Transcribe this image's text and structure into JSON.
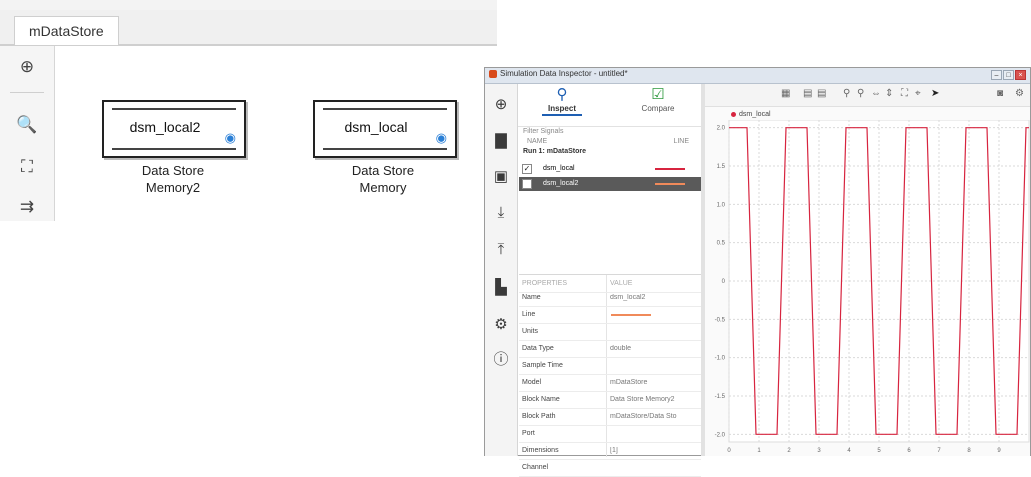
{
  "simulink": {
    "tab_label": "mDataStore",
    "toolbar_icons": [
      "navigate-back-icon",
      "zoom-in-icon",
      "fit-to-view-icon",
      "signal-routing-icon"
    ],
    "blocks": [
      {
        "label": "dsm_local2",
        "caption_line1": "Data Store",
        "caption_line2": "Memory2"
      },
      {
        "label": "dsm_local",
        "caption_line1": "Data Store",
        "caption_line2": "Memory"
      }
    ]
  },
  "sdi": {
    "title": "Simulation Data Inspector - untitled*",
    "window_buttons": [
      "–",
      "□",
      "×"
    ],
    "left_icons": [
      "new-icon",
      "folder-icon",
      "save-icon",
      "import-icon",
      "export-icon",
      "report-icon",
      "settings-icon",
      "help-icon"
    ],
    "modes": {
      "inspect": "Inspect",
      "compare": "Compare"
    },
    "filter_placeholder": "Filter Signals",
    "signal_columns": [
      "NAME",
      "LINE"
    ],
    "run_label": "Run 1: mDataStore",
    "signals": [
      {
        "name": "dsm_local",
        "checked": "✓",
        "line_color": "#d7243f"
      },
      {
        "name": "dsm_local2",
        "checked": "",
        "line_color": "#f08a5a"
      }
    ],
    "properties_header": {
      "key": "PROPERTIES",
      "value": "VALUE"
    },
    "properties": [
      {
        "key": "Name",
        "value": "dsm_local2"
      },
      {
        "key": "Line",
        "value": ""
      },
      {
        "key": "Units",
        "value": ""
      },
      {
        "key": "Data Type",
        "value": "double"
      },
      {
        "key": "Sample Time",
        "value": ""
      },
      {
        "key": "Model",
        "value": "mDataStore"
      },
      {
        "key": "Block Name",
        "value": "Data Store Memory2"
      },
      {
        "key": "Block Path",
        "value": "mDataStore/Data Sto"
      },
      {
        "key": "Port",
        "value": ""
      },
      {
        "key": "Dimensions",
        "value": "[1]"
      },
      {
        "key": "Channel",
        "value": ""
      }
    ],
    "legend_label": "dsm_local",
    "line_color": "#d7243f"
  },
  "chart_data": {
    "type": "line",
    "series": [
      {
        "name": "dsm_local",
        "x": [
          0,
          0.6,
          0.9,
          1.6,
          1.9,
          2.6,
          2.9,
          3.6,
          3.9,
          4.6,
          4.9,
          5.6,
          5.9,
          6.6,
          6.9,
          7.6,
          7.9,
          8.6,
          8.9,
          9.6,
          9.9,
          10
        ],
        "y": [
          2,
          2,
          -2,
          -2,
          2,
          2,
          -2,
          -2,
          2,
          2,
          -2,
          -2,
          2,
          2,
          -2,
          -2,
          2,
          2,
          -2,
          -2,
          2,
          2
        ]
      }
    ],
    "xlim": [
      0,
      10
    ],
    "ylim": [
      -2.1,
      2.1
    ],
    "x_ticks": [
      "0",
      "1",
      "2",
      "3",
      "4",
      "5",
      "6",
      "7",
      "8",
      "9"
    ],
    "y_ticks": [
      "2.0",
      "1.5",
      "1.0",
      "0.5",
      "0",
      "-0.5",
      "-1.0",
      "-1.5",
      "-2.0"
    ],
    "grid": true,
    "legend_position": "top-left"
  }
}
